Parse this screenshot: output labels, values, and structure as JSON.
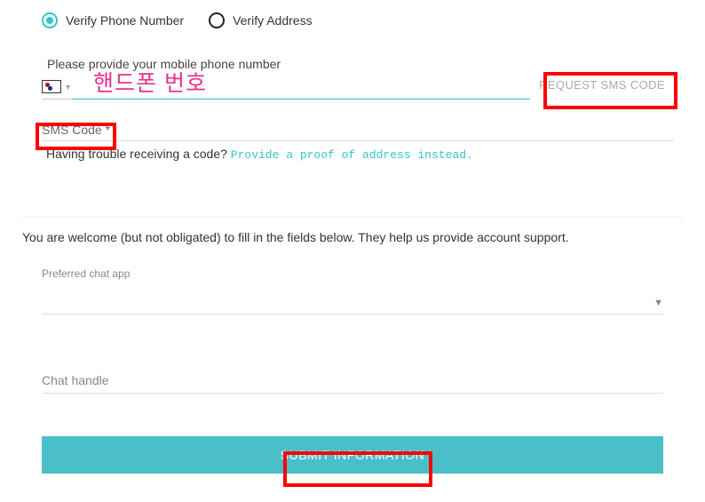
{
  "verify": {
    "phone_label": "Verify Phone Number",
    "address_label": "Verify Address"
  },
  "phone": {
    "prompt": "Please provide your mobile phone number",
    "annotation": "핸드폰 번호",
    "request_button": "REQUEST SMS CODE"
  },
  "sms": {
    "label": "SMS Code *",
    "trouble_text": "Having trouble receiving a code? ",
    "trouble_link": "Provide a proof of address instead."
  },
  "optional": {
    "intro": "You are welcome (but not obligated) to fill in the fields below. They help us provide account support.",
    "chat_app_label": "Preferred chat app",
    "chat_handle_placeholder": "Chat handle"
  },
  "submit_label": "SUBMIT INFORMATION"
}
